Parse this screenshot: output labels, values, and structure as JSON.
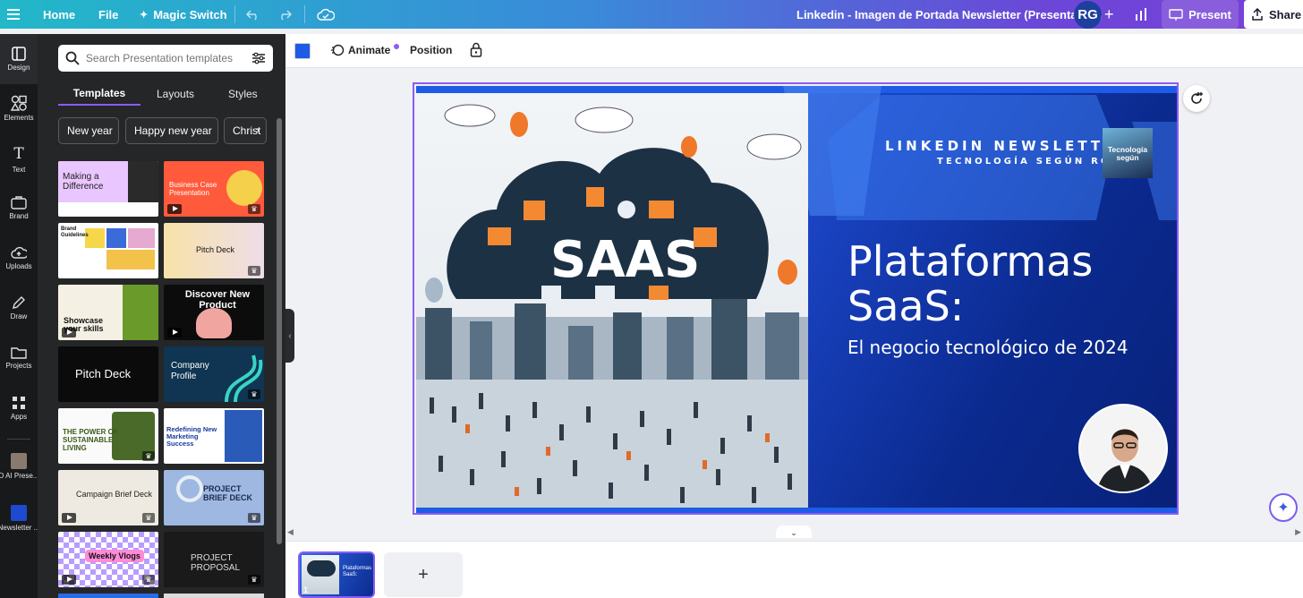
{
  "topbar": {
    "menu_icon": "hamburger-icon",
    "home": "Home",
    "file": "File",
    "magic_switch": "Magic Switch",
    "doc_title": "Linkedin - Imagen de Portada Newsletter (Presentation)",
    "avatar_initials": "RG",
    "present": "Present",
    "share": "Share"
  },
  "rail": {
    "items": [
      {
        "label": "Design",
        "icon": "design-icon"
      },
      {
        "label": "Elements",
        "icon": "elements-icon"
      },
      {
        "label": "Text",
        "icon": "text-icon"
      },
      {
        "label": "Brand",
        "icon": "brand-icon"
      },
      {
        "label": "Uploads",
        "icon": "uploads-icon"
      },
      {
        "label": "Draw",
        "icon": "draw-icon"
      },
      {
        "label": "Projects",
        "icon": "projects-icon"
      },
      {
        "label": "Apps",
        "icon": "apps-icon"
      },
      {
        "label": "D AI Prese...",
        "icon": "app-thumb"
      },
      {
        "label": "Newsletter ...",
        "icon": "app-thumb"
      }
    ]
  },
  "panel": {
    "search_placeholder": "Search Presentation templates",
    "tabs": [
      "Templates",
      "Layouts",
      "Styles"
    ],
    "chips": [
      "New year",
      "Happy new year",
      "Christ"
    ],
    "templates": [
      {
        "title": "Making a Difference",
        "bg": "#f3f0ff"
      },
      {
        "title": "Business Case Presentation",
        "bg": "#ff5a3c"
      },
      {
        "title": "Brand Guidelines",
        "bg": "#ffffff"
      },
      {
        "title": "Pitch Deck",
        "bg": "#fde7c8"
      },
      {
        "title": "Showcase your skills",
        "bg": "#f4f1e4"
      },
      {
        "title": "Discover New Product",
        "bg": "#0c0c0c"
      },
      {
        "title": "Pitch Deck",
        "bg": "#0b0b0b"
      },
      {
        "title": "Company Profile",
        "bg": "#0f3552"
      },
      {
        "title": "THE POWER OF SUSTAINABLE LIVING",
        "bg": "#fafafa"
      },
      {
        "title": "Redefining New Marketing Success",
        "bg": "#ffffff"
      },
      {
        "title": "Campaign Brief Deck",
        "bg": "#efeae1"
      },
      {
        "title": "PROJECT BRIEF DECK",
        "bg": "#9fb8e2"
      },
      {
        "title": "Weekly Vlogs",
        "bg": "#d7c6ff"
      },
      {
        "title": "PROJECT PROPOSAL",
        "bg": "#1a1a1a"
      }
    ]
  },
  "toolbar": {
    "animate": "Animate",
    "position": "Position",
    "fill_color": "#1e5be6"
  },
  "slide": {
    "newsletter_heading": "LINKEDIN NEWSLETTER",
    "newsletter_sub": "TECNOLOGÍA SEGÚN ROB",
    "card_text": "Tecnología según",
    "title_line1": "Plataformas",
    "title_line2": "SaaS:",
    "subtitle": "El negocio tecnológico de 2024",
    "hero_word": "SAAS"
  },
  "pages": {
    "current_page": "1",
    "thumb_title": "Plataformas SaaS:"
  }
}
